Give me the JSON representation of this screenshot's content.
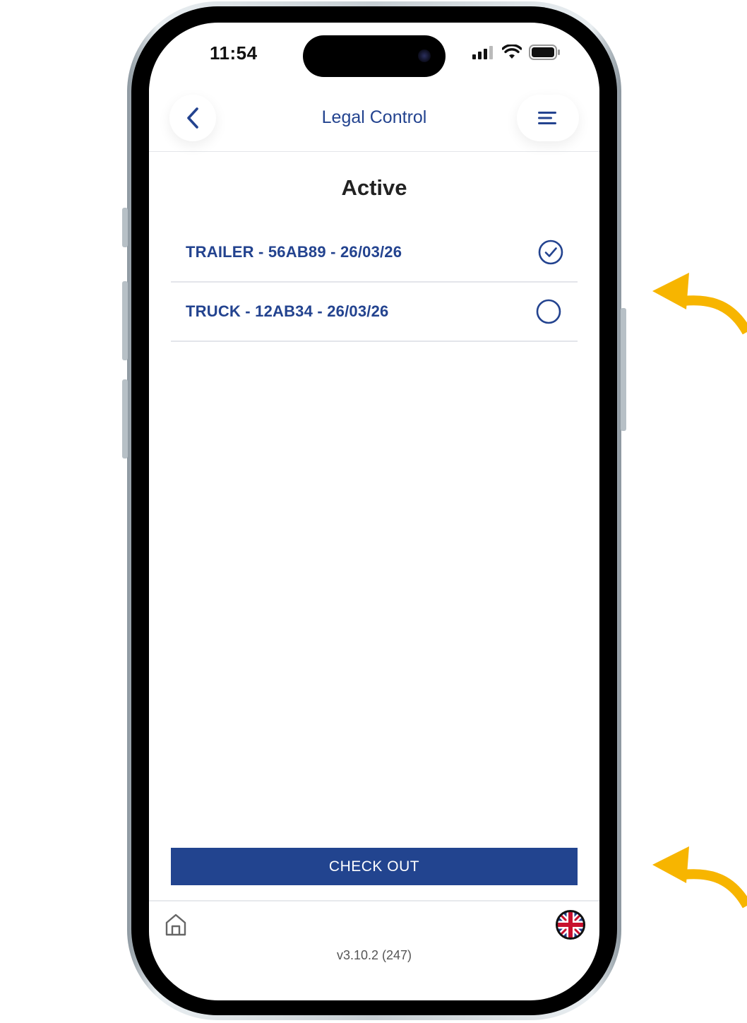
{
  "status_bar": {
    "time": "11:54"
  },
  "header": {
    "title": "Legal Control",
    "back_icon": "chevron-left-icon",
    "menu_icon": "hamburger-menu-icon"
  },
  "main": {
    "section_title": "Active",
    "items": [
      {
        "label": "TRAILER - 56AB89 - 26/03/26",
        "selected": true
      },
      {
        "label": "TRUCK - 12AB34 - 26/03/26",
        "selected": false
      }
    ],
    "checkout_label": "CHECK OUT"
  },
  "footer": {
    "version": "v3.10.2 (247)",
    "home_icon": "home-icon",
    "language_icon": "uk-flag-icon"
  },
  "colors": {
    "primary": "#23438f",
    "button": "#22448f",
    "annotation_arrow": "#f7b500"
  }
}
